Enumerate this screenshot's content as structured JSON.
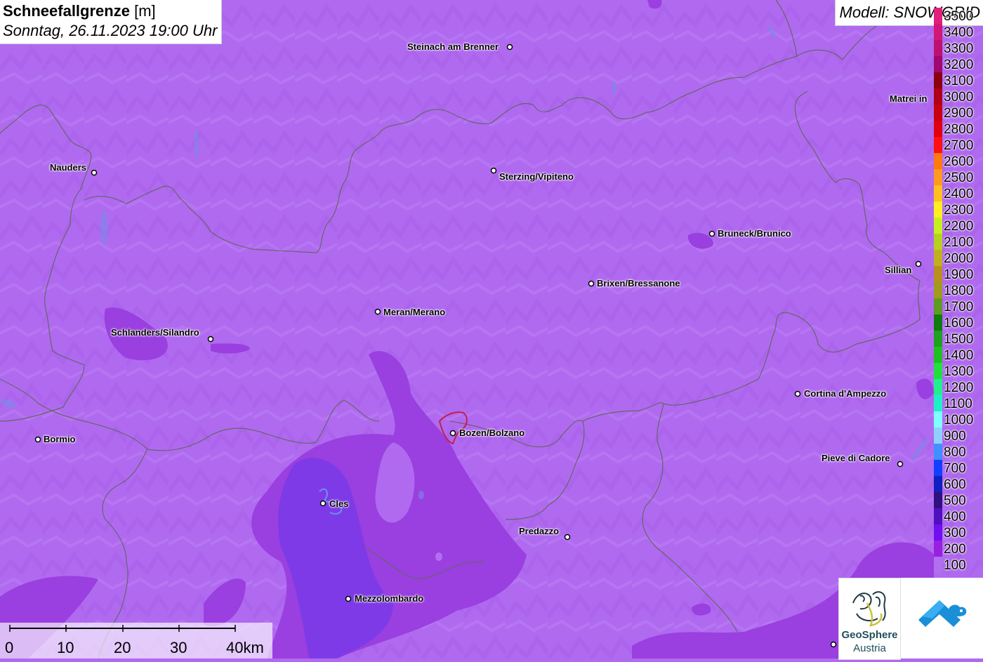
{
  "header": {
    "title": "Schneefallgrenze",
    "unit": "[m]",
    "datetime": "Sonntag, 26.11.2023 19:00 Uhr",
    "model": "Modell: SNOWGRID"
  },
  "cities": [
    {
      "name": "Steinach am Brenner",
      "id": "steinach"
    },
    {
      "name": "Nauders",
      "id": "nauders"
    },
    {
      "name": "Sterzing/Vipiteno",
      "id": "sterzing"
    },
    {
      "name": "Matrei in",
      "id": "matrei"
    },
    {
      "name": "Bruneck/Brunico",
      "id": "bruneck"
    },
    {
      "name": "Sillian",
      "id": "sillian"
    },
    {
      "name": "Brixen/Bressanone",
      "id": "brixen"
    },
    {
      "name": "Meran/Merano",
      "id": "meran"
    },
    {
      "name": "Schlanders/Silandro",
      "id": "schlanders"
    },
    {
      "name": "Cortina d'Ampezzo",
      "id": "cortina"
    },
    {
      "name": "Bormio",
      "id": "bormio"
    },
    {
      "name": "Bozen/Bolzano",
      "id": "bozen"
    },
    {
      "name": "Pieve di Cadore",
      "id": "pieve"
    },
    {
      "name": "Cles",
      "id": "cles"
    },
    {
      "name": "Predazzo",
      "id": "predazzo"
    },
    {
      "name": "Mezzolombardo",
      "id": "mezzolombardo"
    }
  ],
  "legend": [
    {
      "label": "3500",
      "color": "#e0207a"
    },
    {
      "label": "3400",
      "color": "#d21874"
    },
    {
      "label": "3300",
      "color": "#be1070"
    },
    {
      "label": "3200",
      "color": "#a00870"
    },
    {
      "label": "3100",
      "color": "#8a0010"
    },
    {
      "label": "3000",
      "color": "#b00018"
    },
    {
      "label": "2900",
      "color": "#c80010"
    },
    {
      "label": "2800",
      "color": "#e00010"
    },
    {
      "label": "2700",
      "color": "#ff1010"
    },
    {
      "label": "2600",
      "color": "#ff7a10"
    },
    {
      "label": "2500",
      "color": "#ff9a20"
    },
    {
      "label": "2400",
      "color": "#ffc020"
    },
    {
      "label": "2300",
      "color": "#ffee20"
    },
    {
      "label": "2200",
      "color": "#c8f020"
    },
    {
      "label": "2100",
      "color": "#b8d020"
    },
    {
      "label": "2000",
      "color": "#c0b020"
    },
    {
      "label": "1900",
      "color": "#b89020"
    },
    {
      "label": "1800",
      "color": "#a09a20"
    },
    {
      "label": "1700",
      "color": "#609a20"
    },
    {
      "label": "1600",
      "color": "#107a10"
    },
    {
      "label": "1500",
      "color": "#20a020"
    },
    {
      "label": "1400",
      "color": "#20c020"
    },
    {
      "label": "1300",
      "color": "#20e040"
    },
    {
      "label": "1200",
      "color": "#20f090"
    },
    {
      "label": "1100",
      "color": "#20f0c8"
    },
    {
      "label": "1000",
      "color": "#80ffff"
    },
    {
      "label": "900",
      "color": "#90d0ff"
    },
    {
      "label": "800",
      "color": "#4090ff"
    },
    {
      "label": "700",
      "color": "#1040ff"
    },
    {
      "label": "600",
      "color": "#1020c0"
    },
    {
      "label": "500",
      "color": "#301080"
    },
    {
      "label": "400",
      "color": "#5010c0"
    },
    {
      "label": "300",
      "color": "#7010f0"
    },
    {
      "label": "200",
      "color": "#9a20e0"
    },
    {
      "label": "100",
      "color": "#b070f0"
    }
  ],
  "scalebar": {
    "ticks": [
      "0",
      "10",
      "20",
      "30",
      "40km"
    ]
  },
  "logos": {
    "geosphere_line1": "GeoSphere",
    "geosphere_line2": "Austria"
  },
  "colors": {
    "base_fill": "#b06af0",
    "mid_fill": "#9a3fe0",
    "low_fill": "#8a2cd8",
    "lowest_fill": "#7a3ae8",
    "border_line": "#666666",
    "bolzano_outline": "#c0204a"
  }
}
